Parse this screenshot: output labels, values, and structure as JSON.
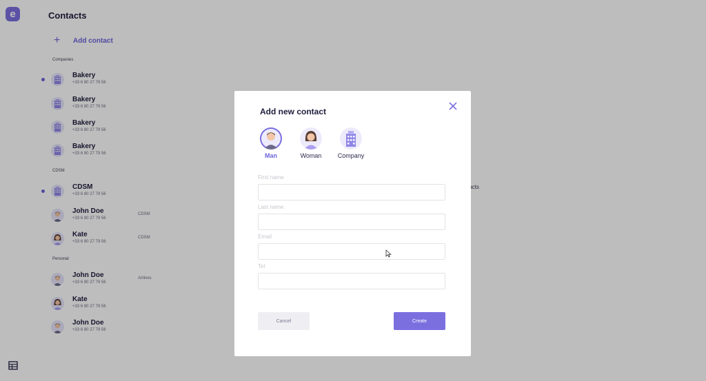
{
  "app": {
    "logo_letter": "e",
    "title": "Contacts",
    "add_contact_label": "Add contact",
    "table_icon": "table-icon"
  },
  "sections": [
    {
      "label": "Companies"
    },
    {
      "label": "CDSM"
    },
    {
      "label": "Personal"
    }
  ],
  "contacts": [
    {
      "name": "Bakery",
      "phone": "+33 6 80 27 79 56",
      "company": "",
      "avatar": "building-icon",
      "active": true
    },
    {
      "name": "Bakery",
      "phone": "+33 6 80 27 79 56",
      "company": "",
      "avatar": "building-icon",
      "active": false
    },
    {
      "name": "Bakery",
      "phone": "+33 6 80 27 79 56",
      "company": "",
      "avatar": "building-icon",
      "active": false
    },
    {
      "name": "Bakery",
      "phone": "+33 6 80 27 79 56",
      "company": "",
      "avatar": "building-icon",
      "active": false
    },
    {
      "name": "CDSM",
      "phone": "+33 6 80 27 79 56",
      "company": "",
      "avatar": "building-icon",
      "active": true
    },
    {
      "name": "John Doe",
      "phone": "+33 6 80 27 79 56",
      "company": "CDSM",
      "avatar": "man-avatar-icon",
      "active": false
    },
    {
      "name": "Kate",
      "phone": "+33 6 80 27 79 56",
      "company": "CDSM",
      "avatar": "woman-avatar-icon",
      "active": false
    },
    {
      "name": "John Doe",
      "phone": "+33 6 80 27 79 56",
      "company": "Airlines",
      "avatar": "man-avatar-icon",
      "active": false
    },
    {
      "name": "Kate",
      "phone": "+33 6 80 27 79 56",
      "company": "",
      "avatar": "woman-avatar-icon",
      "active": false
    },
    {
      "name": "John Doe",
      "phone": "+33 6 80 27 79 56",
      "company": "",
      "avatar": "man-avatar-icon",
      "active": false
    }
  ],
  "background_text": "tacts",
  "modal": {
    "title": "Add new contact",
    "close_icon": "close-icon",
    "types": [
      {
        "label": "Man",
        "icon": "man-avatar-icon",
        "selected": true
      },
      {
        "label": "Woman",
        "icon": "woman-avatar-icon",
        "selected": false
      },
      {
        "label": "Company",
        "icon": "building-icon",
        "selected": false
      }
    ],
    "fields": [
      {
        "label": "First name",
        "value": ""
      },
      {
        "label": "Last name",
        "value": ""
      },
      {
        "label": "Email",
        "value": ""
      },
      {
        "label": "Tel",
        "value": ""
      }
    ],
    "cancel_label": "Cancel",
    "create_label": "Create"
  },
  "colors": {
    "accent": "#7b6fe0",
    "overlay": "rgba(0,0,0,0.26)"
  }
}
